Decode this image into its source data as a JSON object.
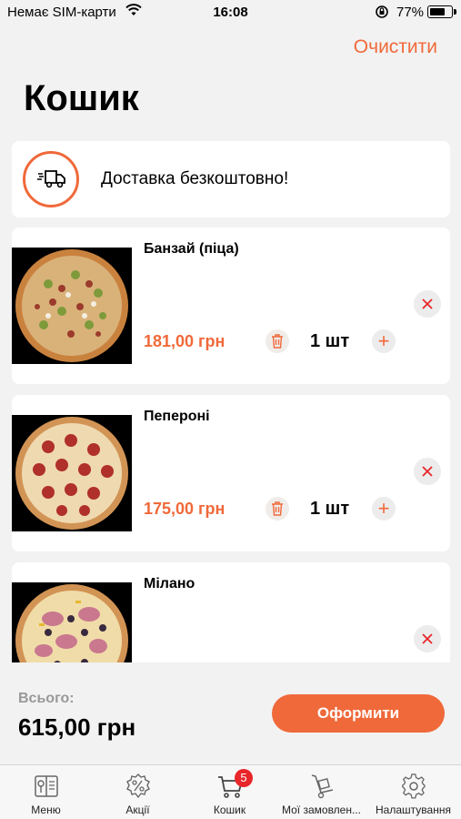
{
  "status_bar": {
    "carrier": "Немає SIM-карти",
    "time": "16:08",
    "battery": "77%",
    "battery_level": 0.77
  },
  "header": {
    "clear_label": "Очистити",
    "title": "Кошик"
  },
  "delivery": {
    "text": "Доставка безкоштовно!"
  },
  "items": [
    {
      "name": "Банзай (піца)",
      "price": "181,00 грн",
      "qty": "1 шт",
      "style": "banzai"
    },
    {
      "name": "Пепероні",
      "price": "175,00 грн",
      "qty": "1 шт",
      "style": "pepperoni"
    },
    {
      "name": "Мілано",
      "price": "",
      "qty": "",
      "style": "milano"
    }
  ],
  "summary": {
    "label": "Всього:",
    "total": "615,00 грн",
    "checkout_label": "Оформити"
  },
  "tabs": [
    {
      "label": "Меню",
      "icon": "menu-book-icon"
    },
    {
      "label": "Акції",
      "icon": "percent-badge-icon"
    },
    {
      "label": "Кошик",
      "icon": "cart-icon",
      "badge": "5"
    },
    {
      "label": "Мої замовлен...",
      "icon": "hand-truck-icon"
    },
    {
      "label": "Налаштування",
      "icon": "gear-icon"
    }
  ],
  "colors": {
    "accent": "#f0693a",
    "badge": "#e8262a",
    "background": "#f2f2f2"
  }
}
